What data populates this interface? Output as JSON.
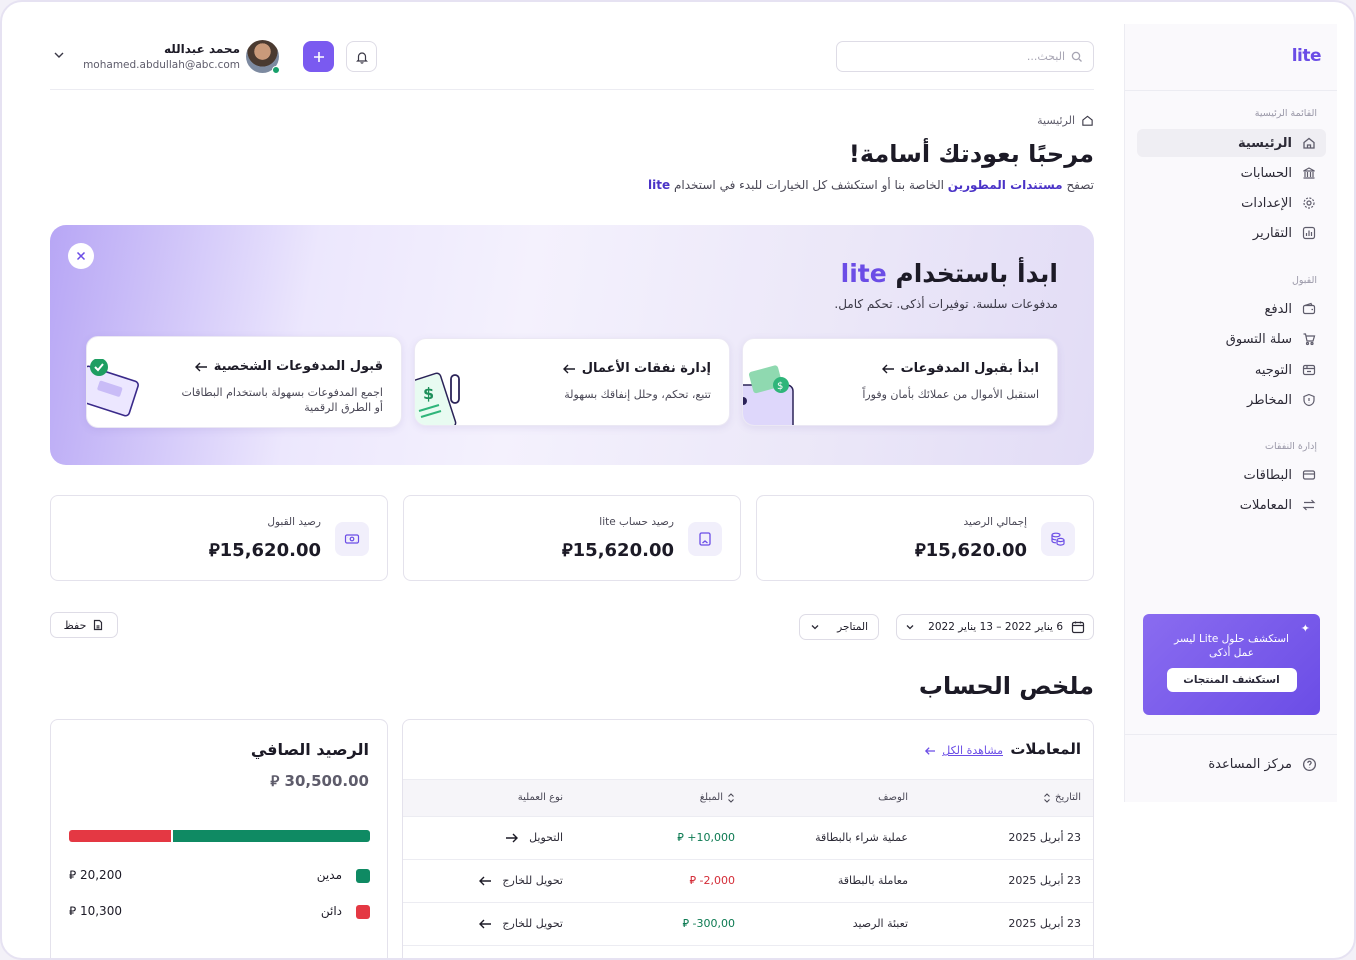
{
  "colors": {
    "accent": "#6b4de6",
    "positive": "#0d7a52",
    "negative": "#d42d38"
  },
  "sidebar": {
    "logo": "lite",
    "sections": {
      "main": "القائمة الرئيسية",
      "acceptance": "القبول",
      "expenses": "إدارة النفقات"
    },
    "items": [
      {
        "label": "الرئيسية",
        "icon": "home-icon",
        "active": true
      },
      {
        "label": "الحسابات",
        "icon": "bank-icon"
      },
      {
        "label": "الإعدادات",
        "icon": "gear-icon"
      },
      {
        "label": "التقارير",
        "icon": "chart-icon"
      },
      {
        "label": "الدفع",
        "icon": "wallet-icon"
      },
      {
        "label": "سلة التسوق",
        "icon": "cart-icon"
      },
      {
        "label": "التوجيه",
        "icon": "routing-icon"
      },
      {
        "label": "المخاطر",
        "icon": "shield-icon"
      },
      {
        "label": "البطاقات",
        "icon": "card-icon"
      },
      {
        "label": "المعاملات",
        "icon": "swap-icon"
      }
    ],
    "promo": {
      "text": "استكشف حلول Lite ليسر عمل أذكى",
      "button": "استكشف المنتجات"
    },
    "help": "مركز المساعدة"
  },
  "header": {
    "search_placeholder": "البحث...",
    "user_name": "محمد عبدالله",
    "user_email": "mohamed.abdullah@abc.com"
  },
  "page": {
    "breadcrumb": "الرئيسية",
    "title": "مرحبًا بعودتك أسامة!",
    "subtitle_pre": "تصفح",
    "subtitle_link": "مستندات المطورين",
    "subtitle_mid": "الخاصة بنا أو استكشف كل الخيارات للبدء في استخدام",
    "subtitle_brand": "lite"
  },
  "banner": {
    "title_pre": "ابدأ باستخدام",
    "title_brand": "lite",
    "subtitle": "مدفوعات سلسة. توفيرات أذكى. تحكم كامل.",
    "cards": [
      {
        "title": "ابدأ بقبول المدفوعات",
        "desc": "استقبل الأموال من عملائك بأمان وفوراً"
      },
      {
        "title": "إدارة نفقات الأعمال",
        "desc": "تتبع، تحكم، وحلل إنفاقك بسهولة"
      },
      {
        "title": "قبول المدفوعات الشخصية",
        "desc": "اجمع المدفوعات بسهولة باستخدام البطاقات أو الطرق الرقمية"
      }
    ]
  },
  "stats": [
    {
      "label": "إجمالي الرصيد",
      "value": "15,620.00",
      "icon": "coins-icon"
    },
    {
      "label": "رصيد حساب lite",
      "value": "15,620.00",
      "icon": "book-icon"
    },
    {
      "label": "رصيد القبول",
      "value": "15,620.00",
      "icon": "cash-icon"
    }
  ],
  "currency_symbol": "⃁",
  "filters": {
    "date_range": "6 يناير 2022 – 13 يناير 2022",
    "stores": "المتاجر",
    "save": "حفظ"
  },
  "summary": {
    "title": "ملخص الحساب",
    "transactions": {
      "title": "المعاملات",
      "view_all": "مشاهدة الكل",
      "columns": {
        "date": "التاريخ",
        "desc": "الوصف",
        "amount": "المبلغ",
        "type": "نوع العملية"
      },
      "rows": [
        {
          "date": "23 أبريل 2025",
          "desc": "عملية شراء بالبطاقة",
          "amount": "+10,000",
          "type": "التحويل",
          "sign": "pos"
        },
        {
          "date": "23 أبريل 2025",
          "desc": "معاملة بالبطاقة",
          "amount": "-2,000",
          "type": "تحويل للخارج",
          "sign": "neg"
        },
        {
          "date": "23 أبريل 2025",
          "desc": "تعبئة الرصيد",
          "amount": "-300,00",
          "type": "تحويل للخارج",
          "sign": "pos"
        }
      ]
    },
    "net": {
      "title": "الرصيد الصافي",
      "value": "30,500.00",
      "debit_label": "مدين",
      "debit_value": "20,200",
      "credit_label": "دائن",
      "credit_value": "10,300",
      "debit_share": 0.66,
      "credit_share": 0.34
    }
  }
}
